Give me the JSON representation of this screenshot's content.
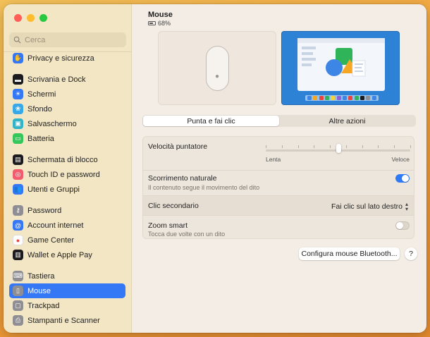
{
  "search": {
    "placeholder": "Cerca"
  },
  "sidebar": {
    "items": [
      {
        "label": "Privacy e sicurezza",
        "icon": "hand-icon",
        "color": "#3478f6",
        "glyph": "✋",
        "group": 0
      },
      {
        "label": "Scrivania e Dock",
        "icon": "dock-icon",
        "color": "#1c1c1e",
        "glyph": "▬",
        "group": 1
      },
      {
        "label": "Schermi",
        "icon": "display-icon",
        "color": "#3478f6",
        "glyph": "☀",
        "group": 1
      },
      {
        "label": "Sfondo",
        "icon": "wallpaper-icon",
        "color": "#37a8e8",
        "glyph": "❀",
        "group": 1
      },
      {
        "label": "Salvaschermo",
        "icon": "screensaver-icon",
        "color": "#30b4c8",
        "glyph": "▣",
        "group": 1
      },
      {
        "label": "Batteria",
        "icon": "battery-icon",
        "color": "#34c759",
        "glyph": "▭",
        "group": 1
      },
      {
        "label": "Schermata di blocco",
        "icon": "lock-screen-icon",
        "color": "#1c1c1e",
        "glyph": "▤",
        "group": 2
      },
      {
        "label": "Touch ID e password",
        "icon": "fingerprint-icon",
        "color": "#f25c6e",
        "glyph": "◎",
        "group": 2
      },
      {
        "label": "Utenti e Gruppi",
        "icon": "users-icon",
        "color": "#3478f6",
        "glyph": "👥",
        "group": 2
      },
      {
        "label": "Password",
        "icon": "key-icon",
        "color": "#8e8e93",
        "glyph": "⚷",
        "group": 3
      },
      {
        "label": "Account internet",
        "icon": "at-icon",
        "color": "#3478f6",
        "glyph": "@",
        "group": 3
      },
      {
        "label": "Game Center",
        "icon": "game-center-icon",
        "color": "#ffffff",
        "glyph": "●",
        "group": 3
      },
      {
        "label": "Wallet e Apple Pay",
        "icon": "wallet-icon",
        "color": "#1c1c1e",
        "glyph": "▥",
        "group": 3
      },
      {
        "label": "Tastiera",
        "icon": "keyboard-icon",
        "color": "#8e8e93",
        "glyph": "⌨",
        "group": 4
      },
      {
        "label": "Mouse",
        "icon": "mouse-icon",
        "color": "#8e8e93",
        "glyph": "▯",
        "group": 4,
        "active": true
      },
      {
        "label": "Trackpad",
        "icon": "trackpad-icon",
        "color": "#8e8e93",
        "glyph": "▢",
        "group": 4
      },
      {
        "label": "Stampanti e Scanner",
        "icon": "printer-icon",
        "color": "#8e8e93",
        "glyph": "⎙",
        "group": 4
      }
    ]
  },
  "header": {
    "title": "Mouse",
    "battery": "68%",
    "battery_level": 0.68
  },
  "tabs": [
    {
      "label": "Punta e fai clic",
      "active": true
    },
    {
      "label": "Altre azioni",
      "active": false
    }
  ],
  "settings": {
    "speed": {
      "label": "Velocità puntatore",
      "min_label": "Lenta",
      "max_label": "Veloce",
      "value": 0.5
    },
    "natural_scroll": {
      "label": "Scorrimento naturale",
      "description": "Il contenuto segue il movimento del dito",
      "enabled": true
    },
    "secondary_click": {
      "label": "Clic secondario",
      "value": "Fai clic sul lato destro"
    },
    "smart_zoom": {
      "label": "Zoom smart",
      "description": "Tocca due volte con un dito",
      "enabled": false
    }
  },
  "footer": {
    "bluetooth_button": "Configura mouse Bluetooth...",
    "help": "?"
  },
  "colors": {
    "accent": "#3478f6",
    "sidebar_bg": "#f3e6c5",
    "main_bg": "#f3ede6"
  }
}
